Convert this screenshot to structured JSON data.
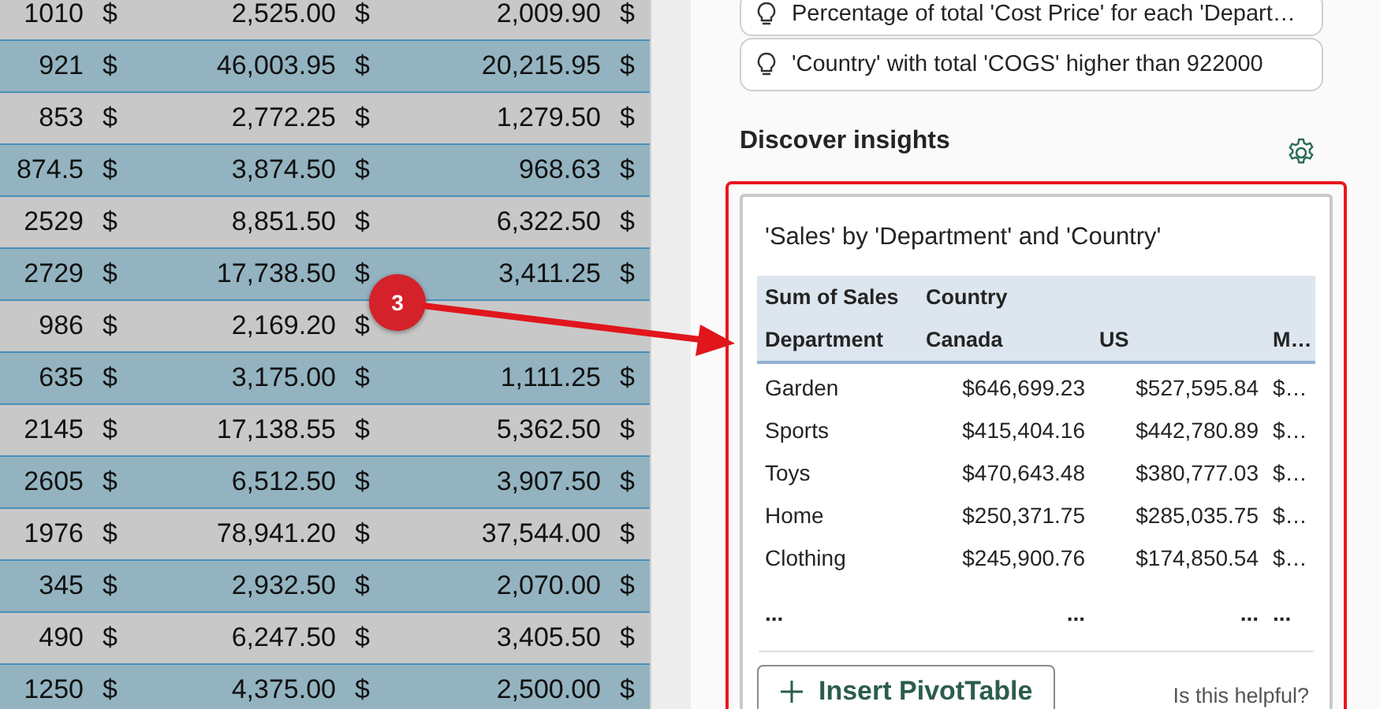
{
  "sheet": {
    "rows": [
      {
        "cells": [
          "1010",
          "$",
          "2,525.00",
          "$",
          "2,009.90",
          "$"
        ]
      },
      {
        "cells": [
          "921",
          "$",
          "46,003.95",
          "$",
          "20,215.95",
          "$"
        ]
      },
      {
        "cells": [
          "853",
          "$",
          "2,772.25",
          "$",
          "1,279.50",
          "$"
        ]
      },
      {
        "cells": [
          "874.5",
          "$",
          "3,874.50",
          "$",
          "968.63",
          "$"
        ]
      },
      {
        "cells": [
          "2529",
          "$",
          "8,851.50",
          "$",
          "6,322.50",
          "$"
        ]
      },
      {
        "cells": [
          "2729",
          "$",
          "17,738.50",
          "$",
          "3,411.25",
          "$"
        ]
      },
      {
        "cells": [
          "986",
          "$",
          "2,169.20",
          "$"
        ]
      },
      {
        "cells": [
          "635",
          "$",
          "3,175.00",
          "$",
          "1,111.25",
          "$"
        ]
      },
      {
        "cells": [
          "2145",
          "$",
          "17,138.55",
          "$",
          "5,362.50",
          "$"
        ]
      },
      {
        "cells": [
          "2605",
          "$",
          "6,512.50",
          "$",
          "3,907.50",
          "$"
        ]
      },
      {
        "cells": [
          "1976",
          "$",
          "78,941.20",
          "$",
          "37,544.00",
          "$"
        ]
      },
      {
        "cells": [
          "345",
          "$",
          "2,932.50",
          "$",
          "2,070.00",
          "$"
        ]
      },
      {
        "cells": [
          "490",
          "$",
          "6,247.50",
          "$",
          "3,405.50",
          "$"
        ]
      },
      {
        "cells": [
          "1250",
          "$",
          "4,375.00",
          "$",
          "2,500.00",
          "$"
        ]
      }
    ]
  },
  "callout": {
    "label": "3"
  },
  "suggestions": [
    {
      "text": "Percentage of total 'Cost Price' for each 'Depart…"
    },
    {
      "text": "'Country' with total 'COGS' higher than 922000"
    }
  ],
  "insights": {
    "heading": "Discover insights",
    "card": {
      "title": "'Sales' by 'Department' and 'Country'",
      "header_1": [
        "Sum of Sales",
        "Country"
      ],
      "header_2": [
        "Department",
        "Canada",
        "US",
        "M…"
      ],
      "rows": [
        {
          "cells": [
            "Garden",
            "$646,699.23",
            "$527,595.84",
            "$…"
          ]
        },
        {
          "cells": [
            "Sports",
            "$415,404.16",
            "$442,780.89",
            "$…"
          ]
        },
        {
          "cells": [
            "Toys",
            "$470,643.48",
            "$380,777.03",
            "$…"
          ]
        },
        {
          "cells": [
            "Home",
            "$250,371.75",
            "$285,035.75",
            "$…"
          ]
        },
        {
          "cells": [
            "Clothing",
            "$245,900.76",
            "$174,850.54",
            "$…"
          ]
        }
      ],
      "more": [
        "...",
        "...",
        "...",
        "..."
      ],
      "insert_button": "Insert PivotTable",
      "feedback": "Is this helpful?"
    }
  }
}
